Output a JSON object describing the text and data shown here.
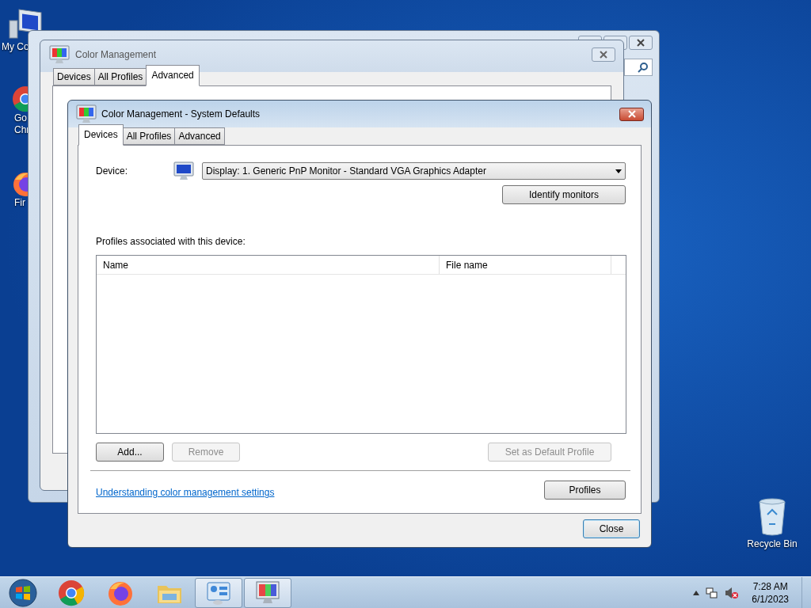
{
  "desktop_icons": [
    {
      "kind": "computer",
      "lines": [
        "My Co"
      ]
    },
    {
      "kind": "chrome",
      "lines": [
        "Go",
        "Chr"
      ]
    },
    {
      "kind": "firefox",
      "lines": [
        "Fir"
      ]
    }
  ],
  "recycle_bin": {
    "label": "Recycle Bin"
  },
  "back_window": {
    "title": "Color Management",
    "tabs": [
      {
        "label": "Devices",
        "selected": false
      },
      {
        "label": "All Profiles",
        "selected": false
      },
      {
        "label": "Advanced",
        "selected": true
      }
    ]
  },
  "dialog": {
    "title": "Color Management - System Defaults",
    "tabs": [
      {
        "label": "Devices",
        "selected": true
      },
      {
        "label": "All Profiles",
        "selected": false
      },
      {
        "label": "Advanced",
        "selected": false
      }
    ],
    "device_label": "Device:",
    "device_value": "Display: 1. Generic PnP Monitor - Standard VGA Graphics Adapter",
    "identify_button": "Identify monitors",
    "profiles_label": "Profiles associated with this device:",
    "columns": [
      "Name",
      "File name"
    ],
    "buttons": [
      {
        "label": "Add...",
        "disabled": false
      },
      {
        "label": "Remove",
        "disabled": true
      },
      {
        "label": "Set as Default Profile",
        "disabled": true
      }
    ],
    "link": "Understanding color management settings",
    "profiles_button": "Profiles",
    "close_button": "Close"
  },
  "taskbar": {
    "apps": [
      {
        "kind": "chrome",
        "active": false
      },
      {
        "kind": "firefox",
        "active": false
      },
      {
        "kind": "folder",
        "active": false
      },
      {
        "kind": "control",
        "active": true
      },
      {
        "kind": "color",
        "active": true
      }
    ],
    "time": "7:28 AM",
    "date": "6/1/2023"
  }
}
